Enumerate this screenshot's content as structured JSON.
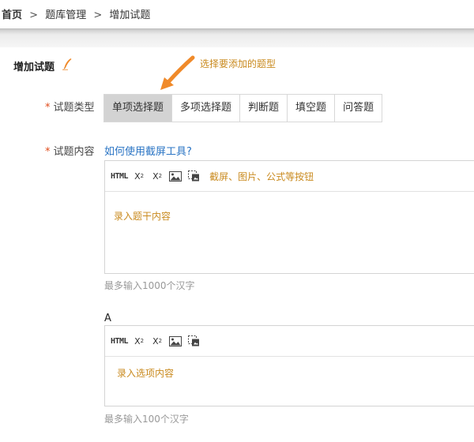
{
  "breadcrumb": {
    "home": "首页",
    "separator": ">",
    "items": [
      "题库管理",
      "增加试题"
    ]
  },
  "page": {
    "section_title": "增加试题",
    "hint": "选择要添加的题型"
  },
  "form": {
    "required_mark": "*",
    "type_label": "试题类型",
    "content_label": "试题内容",
    "help_link": "如何使用截屏工具?"
  },
  "question_types": [
    {
      "label": "单项选择题",
      "selected": true
    },
    {
      "label": "多项选择题",
      "selected": false
    },
    {
      "label": "判断题",
      "selected": false
    },
    {
      "label": "填空题",
      "selected": false
    },
    {
      "label": "问答题",
      "selected": false
    }
  ],
  "editor": {
    "toolbar": {
      "html_label": "HTML",
      "subscript_label": "X",
      "subscript_mark": "2",
      "superscript_label": "X",
      "superscript_mark": "2",
      "note": "截屏、图片、公式等按钮"
    },
    "placeholder": "录入题干内容",
    "limit": "最多输入1000个汉字"
  },
  "option_a": {
    "letter": "A",
    "placeholder": "录入选项内容",
    "limit": "最多输入100个汉字"
  },
  "colors": {
    "hint": "#c98a1e",
    "link": "#2a74c4",
    "required": "#e04a1a",
    "active_tab_bg": "#d3d3d3",
    "arrow": "#f08a2a"
  },
  "icons": [
    "pen-icon",
    "hint-arrow-icon",
    "image-icon",
    "screenshot-icon"
  ]
}
